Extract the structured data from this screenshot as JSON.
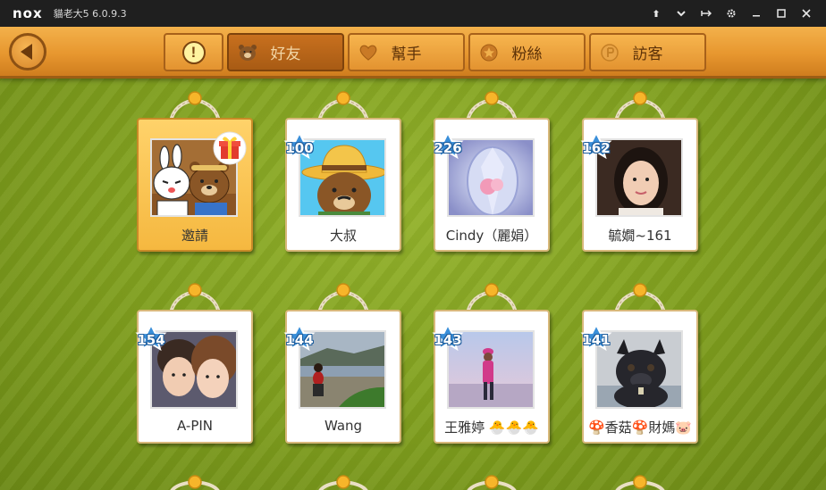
{
  "window": {
    "logo": "nox",
    "title": "貓老大5 6.0.9.3",
    "controls": [
      "pin-icon",
      "chevron-down-icon",
      "expand-icon",
      "gear-icon",
      "minimize-icon",
      "maximize-icon",
      "close-icon"
    ]
  },
  "tabs": [
    {
      "label": "",
      "icon": "alert-icon",
      "active": false
    },
    {
      "label": "好友",
      "icon": "bear-icon",
      "active": true
    },
    {
      "label": "幫手",
      "icon": "heart-icon",
      "active": false
    },
    {
      "label": "粉絲",
      "icon": "star-icon",
      "active": false
    },
    {
      "label": "訪客",
      "icon": "visitor-icon",
      "active": false
    }
  ],
  "friends": [
    {
      "name": "邀請",
      "level": null,
      "invite": true
    },
    {
      "name": "大叔",
      "level": "100"
    },
    {
      "name": "Cindy（麗娟）",
      "level": "226"
    },
    {
      "name": "毓嫺~161",
      "level": "162"
    },
    {
      "name": "A-PIN",
      "level": "154"
    },
    {
      "name": "Wang",
      "level": "144"
    },
    {
      "name": "王雅婷 🐣🐣🐣",
      "level": "143"
    },
    {
      "name": "🍄香菇🍄財媽🐷",
      "level": "141"
    }
  ],
  "colors": {
    "wood": "#e7972f",
    "grass": "#8aa824",
    "level_badge": "#3a8fd9"
  }
}
